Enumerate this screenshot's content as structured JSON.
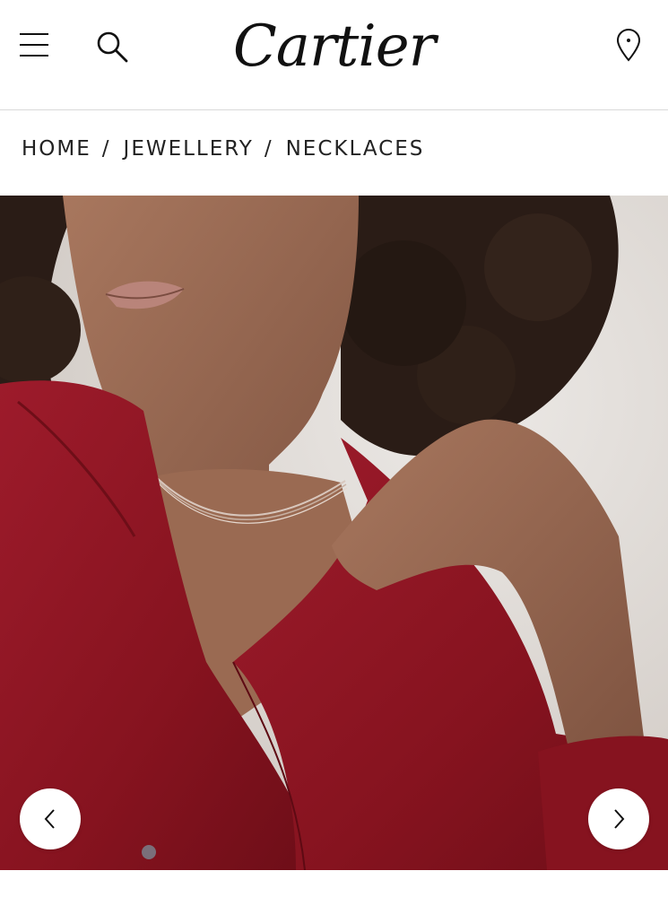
{
  "header": {
    "logo_text": "Cartier",
    "icons": {
      "menu": "hamburger-menu-icon",
      "search": "search-icon",
      "store_locator": "location-pin-icon"
    }
  },
  "breadcrumb": {
    "items": [
      "HOME",
      "JEWELLERY",
      "NECKLACES"
    ],
    "separator": "/"
  },
  "gallery": {
    "image_description": "Model in dark red silk shirt wearing a fine multi-strand necklace",
    "colors": {
      "shirt": "#8b1522",
      "background": "#d9d4cf",
      "skin": "#9a6a52"
    },
    "prev_icon": "chevron-left-icon",
    "next_icon": "chevron-right-icon"
  }
}
